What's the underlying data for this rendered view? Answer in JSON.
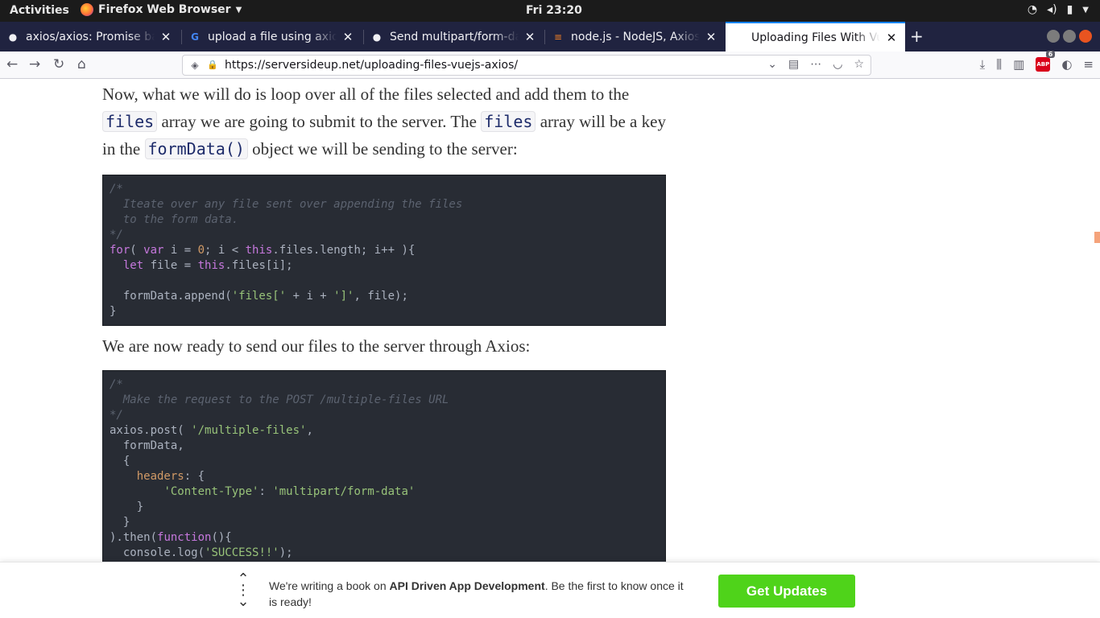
{
  "system": {
    "activities": "Activities",
    "app_name": "Firefox Web Browser",
    "clock": "Fri 23:20"
  },
  "tabs": [
    {
      "title": "axios/axios: Promise based HTTP client",
      "favicon": "github-icon"
    },
    {
      "title": "upload a file using axios - Google Search",
      "favicon": "google-icon"
    },
    {
      "title": "Send multipart/form-data files",
      "favicon": "github-icon"
    },
    {
      "title": "node.js - NodeJS, Axios - post",
      "favicon": "stackoverflow-icon"
    },
    {
      "title": "Uploading Files With VueJS",
      "favicon": "site-icon",
      "active": true
    }
  ],
  "urlbar": {
    "url": "https://serversideup.net/uploading-files-vuejs-axios/"
  },
  "toolbar": {
    "abp_label": "ABP",
    "abp_count": "6"
  },
  "article": {
    "p1_a": "Now, what we will do is loop over all of the files selected and add them to the",
    "p1_code1": "files",
    "p1_b": " array we are going to submit to the server. The ",
    "p1_code2": "files",
    "p1_c": " array will be a key",
    "p1_d": "in the ",
    "p1_code3": "formData()",
    "p1_e": " object we will be sending to the server:",
    "p2": "We are now ready to send our files to the server through Axios:"
  },
  "banner": {
    "msg_a": "We're writing a book on ",
    "msg_bold": "API Driven App Development",
    "msg_b": ". Be the first to know once it is ready!",
    "cta": "Get Updates"
  }
}
